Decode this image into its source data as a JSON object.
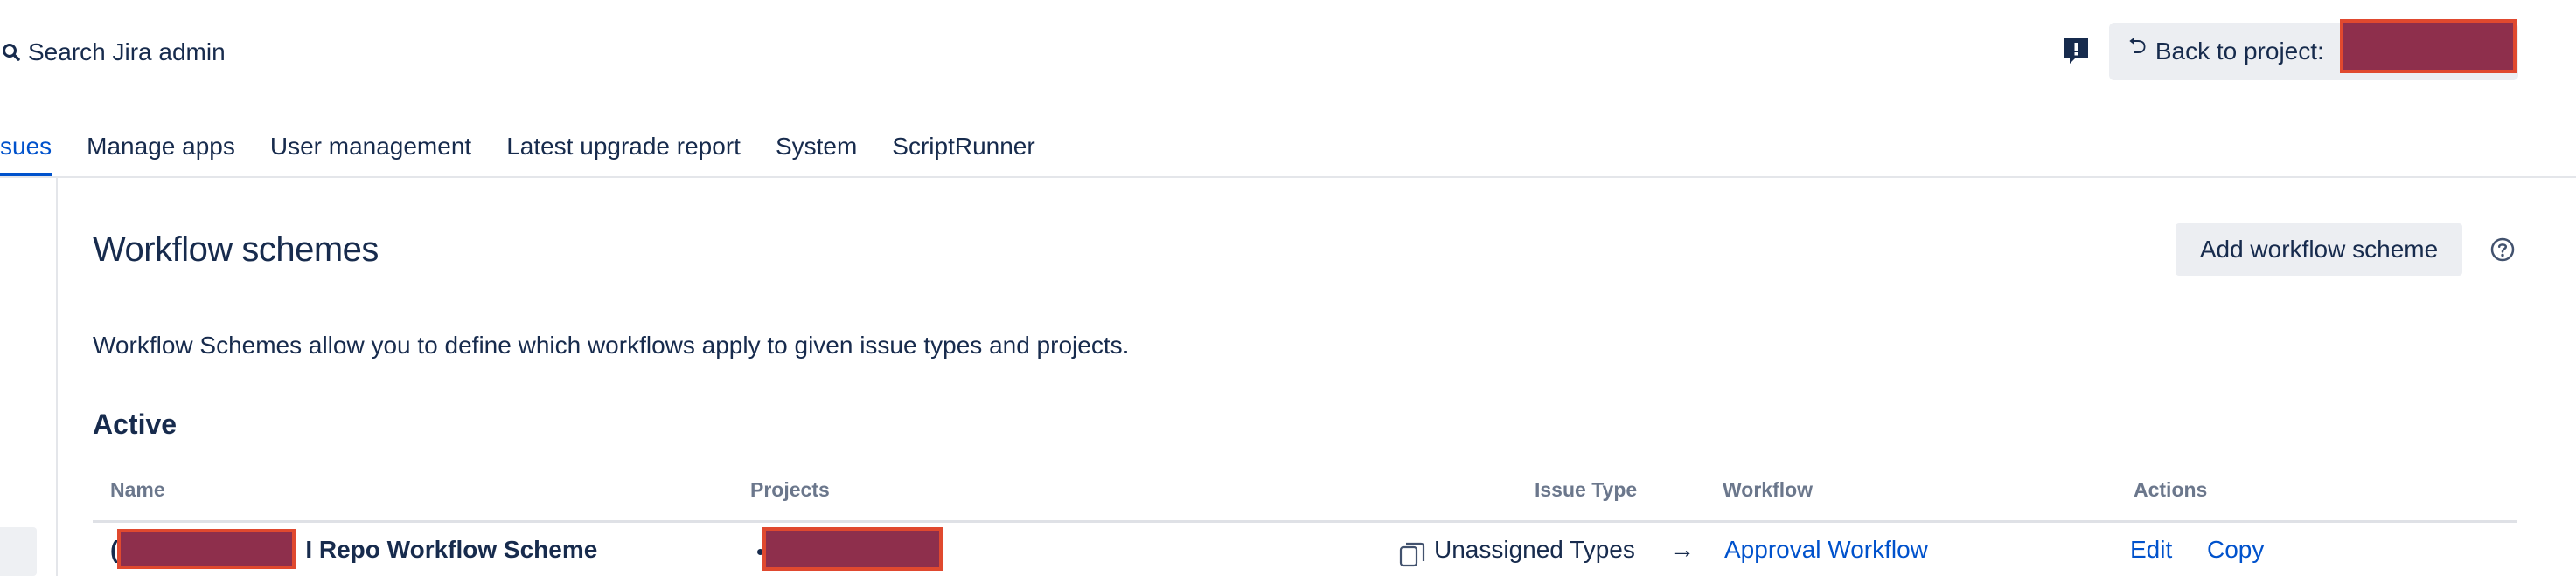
{
  "header": {
    "search_label": "Search Jira admin",
    "back_label": "Back to project:"
  },
  "tabs": [
    {
      "label": "sues",
      "active": true
    },
    {
      "label": "Manage apps",
      "active": false
    },
    {
      "label": "User management",
      "active": false
    },
    {
      "label": "Latest upgrade report",
      "active": false
    },
    {
      "label": "System",
      "active": false
    },
    {
      "label": "ScriptRunner",
      "active": false
    }
  ],
  "page": {
    "title": "Workflow schemes",
    "add_button": "Add workflow scheme",
    "description": "Workflow Schemes allow you to define which workflows apply to given issue types and projects.",
    "section": "Active"
  },
  "table": {
    "headers": {
      "name": "Name",
      "projects": "Projects",
      "issue_type": "Issue Type",
      "workflow": "Workflow",
      "actions": "Actions"
    },
    "rows": [
      {
        "name_prefix": "(",
        "name_suffix": "I Repo Workflow Scheme",
        "issue_type": "Unassigned Types",
        "arrow": "→",
        "workflow": "Approval Workflow",
        "edit": "Edit",
        "copy": "Copy"
      }
    ]
  },
  "colors": {
    "link": "#0052cc",
    "text": "#172b4d",
    "header_muted": "#6b778c",
    "redaction_fill": "#8e2f4c",
    "redaction_border": "#e0492f",
    "button_bg": "#eceef2"
  },
  "icons": {
    "search": "search-icon",
    "feedback": "feedback-icon",
    "back": "back-arrow-icon",
    "help": "help-icon",
    "copy": "copy-icon"
  }
}
